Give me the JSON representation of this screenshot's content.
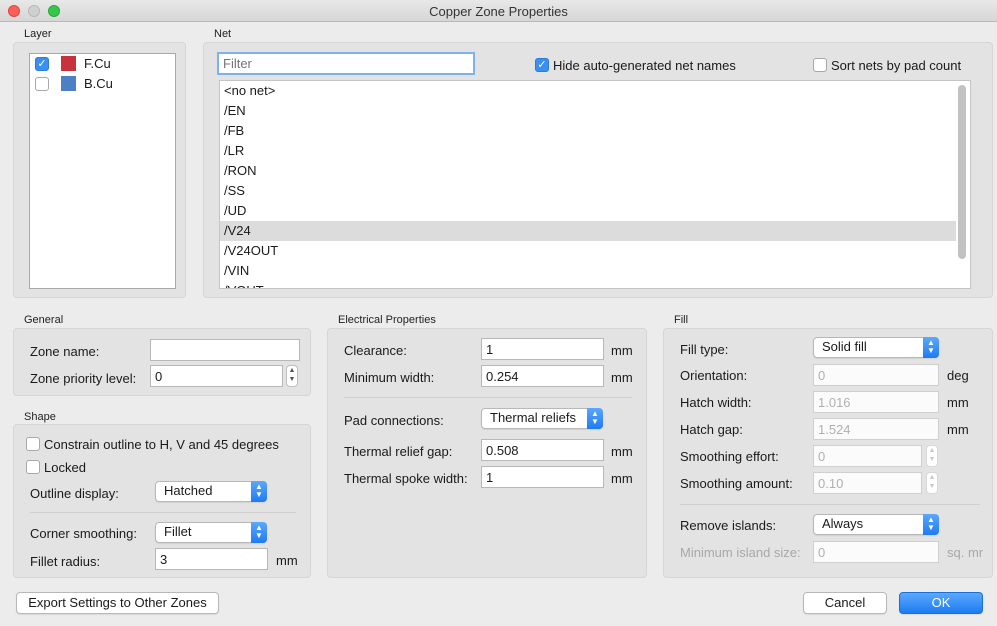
{
  "window": {
    "title": "Copper Zone Properties"
  },
  "layer": {
    "label": "Layer",
    "items": [
      {
        "name": "F.Cu",
        "checked": true,
        "color": "#c8323c"
      },
      {
        "name": "B.Cu",
        "checked": false,
        "color": "#4d7fc4"
      }
    ]
  },
  "net": {
    "label": "Net",
    "filter_placeholder": "Filter",
    "hide_auto_label": "Hide auto-generated net names",
    "sort_by_pad_label": "Sort nets by pad count",
    "items": [
      "<no net>",
      "/EN",
      "/FB",
      "/LR",
      "/RON",
      "/SS",
      "/UD",
      "/V24",
      "/V24OUT",
      "/VIN",
      "/VOUT"
    ],
    "selected": "/V24"
  },
  "general": {
    "label": "General",
    "zone_name_label": "Zone name:",
    "zone_name_value": "",
    "priority_label": "Zone priority level:",
    "priority_value": "0"
  },
  "shape": {
    "label": "Shape",
    "constrain_label": "Constrain outline to H, V and 45 degrees",
    "locked_label": "Locked",
    "outline_display_label": "Outline display:",
    "outline_display_value": "Hatched",
    "corner_smoothing_label": "Corner smoothing:",
    "corner_smoothing_value": "Fillet",
    "fillet_radius_label": "Fillet radius:",
    "fillet_radius_value": "3",
    "unit": "mm"
  },
  "electrical": {
    "label": "Electrical Properties",
    "clearance_label": "Clearance:",
    "clearance_value": "1",
    "min_width_label": "Minimum width:",
    "min_width_value": "0.254",
    "pad_connections_label": "Pad connections:",
    "pad_connections_value": "Thermal reliefs",
    "thermal_gap_label": "Thermal relief gap:",
    "thermal_gap_value": "0.508",
    "thermal_spoke_label": "Thermal spoke width:",
    "thermal_spoke_value": "1",
    "unit": "mm"
  },
  "fill": {
    "label": "Fill",
    "fill_type_label": "Fill type:",
    "fill_type_value": "Solid fill",
    "orientation_label": "Orientation:",
    "orientation_value": "0",
    "orientation_unit": "deg",
    "hatch_width_label": "Hatch width:",
    "hatch_width_value": "1.016",
    "hatch_gap_label": "Hatch gap:",
    "hatch_gap_value": "1.524",
    "smoothing_effort_label": "Smoothing effort:",
    "smoothing_effort_value": "0",
    "smoothing_amount_label": "Smoothing amount:",
    "smoothing_amount_value": "0.10",
    "remove_islands_label": "Remove islands:",
    "remove_islands_value": "Always",
    "min_island_label": "Minimum island size:",
    "min_island_value": "0",
    "min_island_unit": "sq. mr",
    "unit": "mm"
  },
  "footer": {
    "export_label": "Export Settings to Other Zones",
    "cancel_label": "Cancel",
    "ok_label": "OK"
  }
}
